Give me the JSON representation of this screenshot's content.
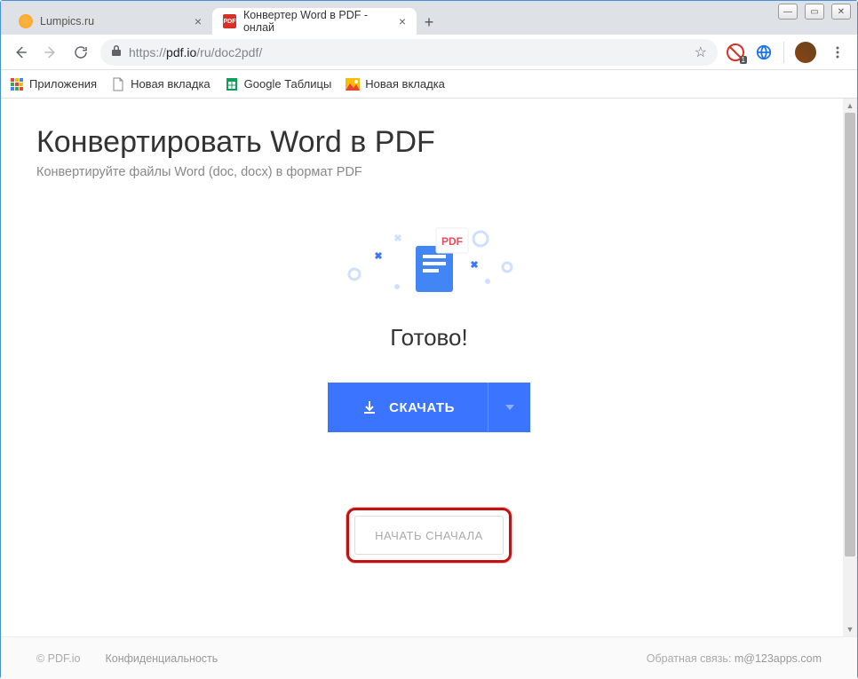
{
  "window": {
    "tabs": [
      {
        "title": "Lumpics.ru",
        "active": false,
        "favicon_color": "#f7a823"
      },
      {
        "title": "Конвертер Word в PDF - онлай",
        "active": true,
        "favicon_label": "PDF",
        "favicon_bg": "#d93025",
        "favicon_fg": "#fff"
      }
    ]
  },
  "toolbar": {
    "url_scheme": "https://",
    "url_host": "pdf.io",
    "url_path": "/ru/doc2pdf/",
    "badge_count": "1"
  },
  "bookmarks": [
    {
      "label": "Приложения",
      "icon": "apps"
    },
    {
      "label": "Новая вкладка",
      "icon": "page"
    },
    {
      "label": "Google Таблицы",
      "icon": "sheets"
    },
    {
      "label": "Новая вкладка",
      "icon": "picture"
    }
  ],
  "page": {
    "heading": "Конвертировать Word в PDF",
    "subheading": "Конвертируйте файлы Word (doc, docx) в формат PDF",
    "ready_label": "Готово!",
    "download_label": "СКАЧАТЬ",
    "restart_label": "НАЧАТЬ СНАЧАЛА",
    "decor_pdf_label": "PDF"
  },
  "footer": {
    "brand": "© PDF.io",
    "privacy": "Конфиденциальность",
    "feedback_label": "Обратная связь: ",
    "feedback_email": "m@123apps.com"
  }
}
